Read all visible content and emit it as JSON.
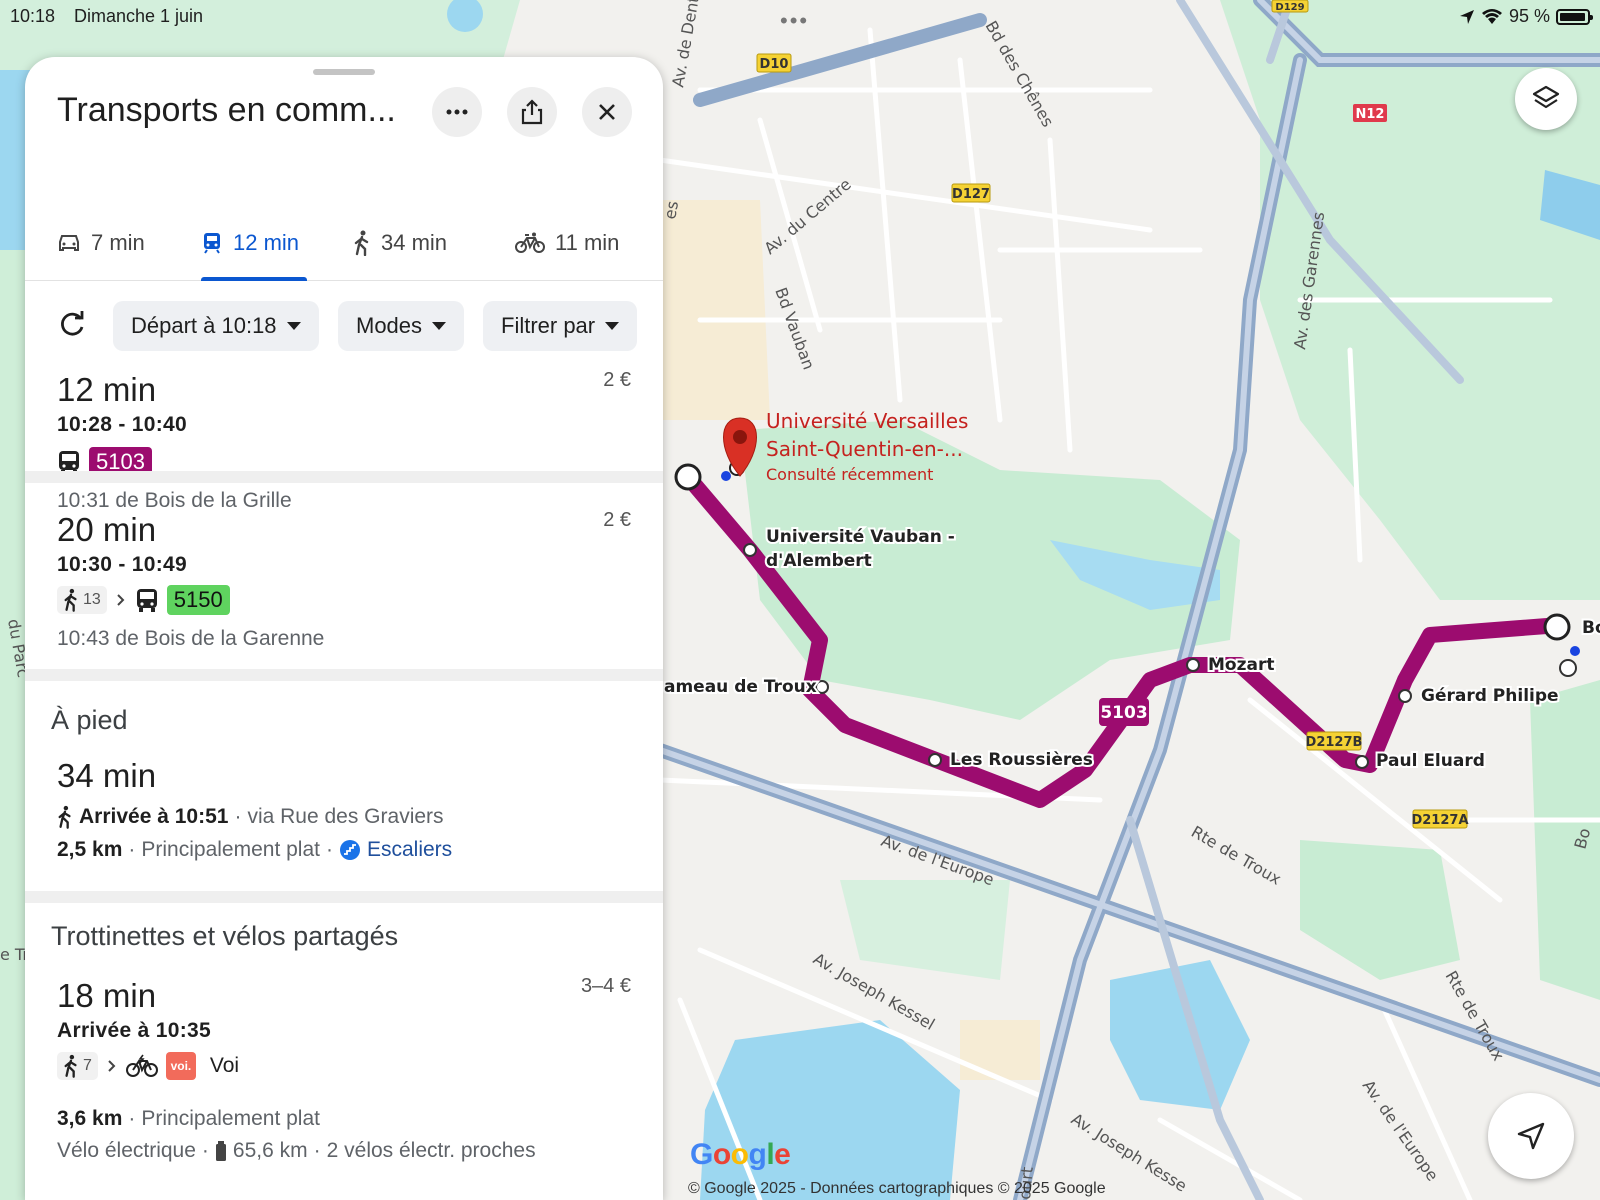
{
  "status_bar": {
    "time": "10:18",
    "date": "Dimanche 1 juin",
    "battery": "95 %",
    "multitask": "•••"
  },
  "panel": {
    "title": "Transports en comm...",
    "tabs": [
      {
        "label": "7 min",
        "icon": "car-icon"
      },
      {
        "label": "12 min",
        "icon": "train-icon",
        "active": true
      },
      {
        "label": "34 min",
        "icon": "walk-icon"
      },
      {
        "label": "11 min",
        "icon": "bike-icon"
      }
    ],
    "controls": {
      "depart": "Départ à 10:18",
      "modes": "Modes",
      "filter": "Filtrer par"
    },
    "routes": [
      {
        "duration": "12 min",
        "times": "10:28 - 10:40",
        "price": "2 €",
        "line": "5103",
        "line_color": "#9c0c6f",
        "departure": "10:31 de Bois de la Grille"
      },
      {
        "duration": "20 min",
        "times": "10:30 - 10:49",
        "price": "2 €",
        "walk_minutes": "13",
        "line": "5150",
        "line_color": "#5fd35f",
        "departure": "10:43 de Bois de la Garenne"
      }
    ],
    "walking": {
      "section_title": "À pied",
      "duration": "34 min",
      "arrival": "Arrivée à 10:51",
      "via": "via Rue des Graviers",
      "distance": "2,5 km",
      "terrain": "Principalement plat",
      "stairs": "Escaliers"
    },
    "shared": {
      "section_title": "Trottinettes et vélos partagés",
      "duration": "18 min",
      "price": "3–4 €",
      "arrival": "Arrivée à 10:35",
      "walk_minutes": "7",
      "operator": "Voi",
      "operator_logo": "voi.",
      "distance": "3,6 km",
      "terrain": "Principalement plat",
      "vehicle": "Vélo électrique",
      "range": "65,6 km",
      "nearby": "2 vélos électr. proches"
    }
  },
  "map": {
    "destination": {
      "name_line1": "Université Versailles",
      "name_line2": "Saint-Quentin-en-...",
      "note": "Consulté récemment"
    },
    "stops": [
      "Université Vauban -",
      "d'Alembert",
      "ameau de Troux",
      "Les Roussières",
      "Mozart",
      "Gérard Philipe",
      "Paul Eluard",
      "Bo"
    ],
    "route_label": "5103",
    "roads": [
      "D10",
      "D127",
      "N12",
      "D2127B",
      "D2127A",
      "Av. du Centre",
      "Bd Vauban",
      "Bd des Chênes",
      "Av. des Garennes",
      "Av. de l'Europe",
      "Rte de Troux",
      "Av. Joseph Kessel",
      "Av. Joseph Kesse",
      "Av. de l'Europe",
      "Av. de Dento",
      "D129",
      "du Parc",
      "Bo",
      "es",
      "e Tr",
      "ourt"
    ],
    "google_logo": [
      "G",
      "o",
      "o",
      "g",
      "l",
      "e"
    ],
    "attribution": "© Google 2025 - Données cartographiques © 2025 Google",
    "colors": {
      "route": "#9c0c6f",
      "park": "#c8ecd3",
      "water": "#9cd7f0",
      "highway": "#8fa8c8",
      "pin": "#d93025"
    }
  }
}
